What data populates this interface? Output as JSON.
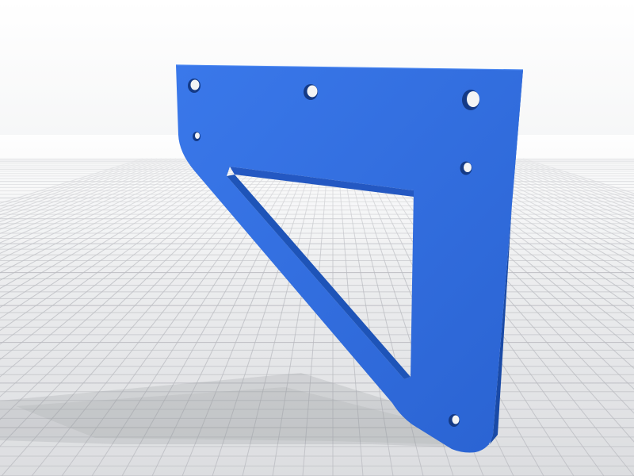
{
  "scene": {
    "background_top_color": "#ffffff",
    "background_bottom_color": "#dcdde0",
    "grid_color": "#b9bbc0",
    "shadow_color": "#8f9296",
    "model": {
      "name": "triangular-bracket",
      "face_color": "#2f6fe0",
      "edge_color": "#1e54b8",
      "hole_count": 7,
      "cutout_shape": "triangle"
    }
  }
}
